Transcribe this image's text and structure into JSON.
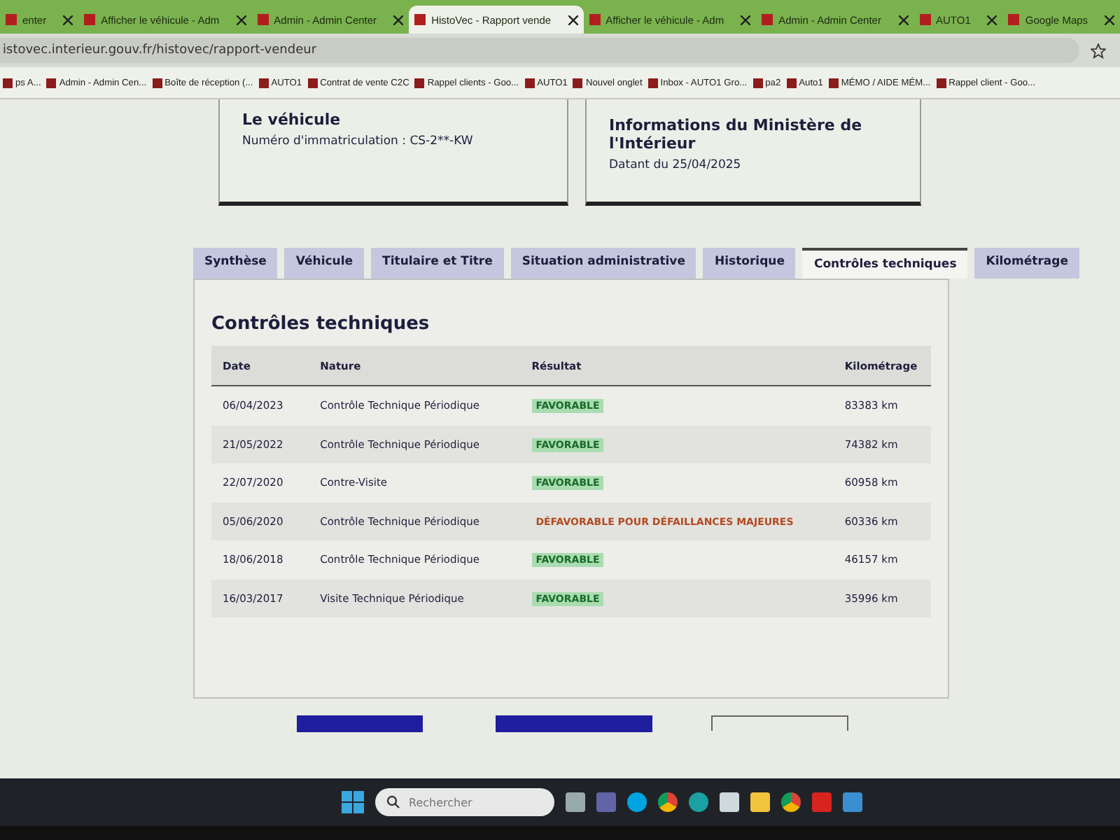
{
  "browser": {
    "tabs": [
      {
        "label": "enter",
        "selected": false
      },
      {
        "label": "Afficher le véhicule - Adm",
        "selected": false
      },
      {
        "label": "Admin - Admin Center",
        "selected": false
      },
      {
        "label": "HistoVec - Rapport vende",
        "selected": true
      },
      {
        "label": "Afficher le véhicule - Adm",
        "selected": false
      },
      {
        "label": "Admin - Admin Center",
        "selected": false
      },
      {
        "label": "AUTO1",
        "selected": false
      },
      {
        "label": "Google Maps",
        "selected": false
      }
    ],
    "address": "istovec.interieur.gouv.fr/histovec/rapport-vendeur",
    "bookmarks": [
      {
        "label": "ps A..."
      },
      {
        "label": "Admin - Admin Cen..."
      },
      {
        "label": "Boîte de réception (..."
      },
      {
        "label": "AUTO1"
      },
      {
        "label": "Contrat de vente C2C"
      },
      {
        "label": "Rappel clients - Goo..."
      },
      {
        "label": "AUTO1"
      },
      {
        "label": "Nouvel onglet"
      },
      {
        "label": "Inbox - AUTO1 Gro..."
      },
      {
        "label": "pa2"
      },
      {
        "label": "Auto1"
      },
      {
        "label": "MÉMO / AIDE MÉM..."
      },
      {
        "label": "Rappel client - Goo..."
      }
    ]
  },
  "cards": [
    {
      "title": "Le véhicule",
      "text": "Numéro d'immatriculation : CS-2**-KW"
    },
    {
      "title": "Informations du Ministère de l'Intérieur",
      "text": "Datant du 25/04/2025"
    }
  ],
  "tabs": [
    {
      "label": "Synthèse",
      "selected": false
    },
    {
      "label": "Véhicule",
      "selected": false
    },
    {
      "label": "Titulaire et Titre",
      "selected": false
    },
    {
      "label": "Situation administrative",
      "selected": false
    },
    {
      "label": "Historique",
      "selected": false
    },
    {
      "label": "Contrôles techniques",
      "selected": true
    },
    {
      "label": "Kilométrage",
      "selected": false
    }
  ],
  "section_title": "Contrôles techniques",
  "table": {
    "columns": [
      "Date",
      "Nature",
      "Résultat",
      "Kilométrage"
    ],
    "rows": [
      {
        "date": "06/04/2023",
        "nature": "Contrôle Technique Périodique",
        "result": "FAVORABLE",
        "favorable": true,
        "km": "83383 km"
      },
      {
        "date": "21/05/2022",
        "nature": "Contrôle Technique Périodique",
        "result": "FAVORABLE",
        "favorable": true,
        "km": "74382 km"
      },
      {
        "date": "22/07/2020",
        "nature": "Contre-Visite",
        "result": "FAVORABLE",
        "favorable": true,
        "km": "60958 km"
      },
      {
        "date": "05/06/2020",
        "nature": "Contrôle Technique Périodique",
        "result": "DÉFAVORABLE POUR DÉFAILLANCES MAJEURES",
        "favorable": false,
        "km": "60336 km"
      },
      {
        "date": "18/06/2018",
        "nature": "Contrôle Technique Périodique",
        "result": "FAVORABLE",
        "favorable": true,
        "km": "46157 km"
      },
      {
        "date": "16/03/2017",
        "nature": "Visite Technique Périodique",
        "result": "FAVORABLE",
        "favorable": true,
        "km": "35996 km"
      }
    ]
  },
  "taskbar": {
    "search_placeholder": "Rechercher"
  }
}
